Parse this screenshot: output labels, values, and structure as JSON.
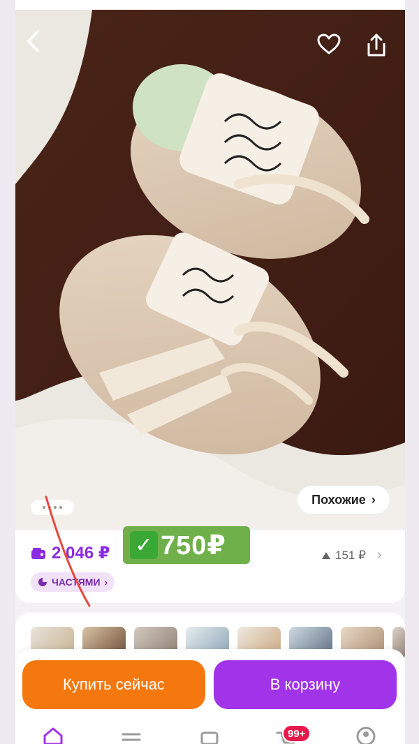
{
  "hero": {
    "similar_label": "Похожие",
    "similar_chevron": "›"
  },
  "price": {
    "current": "2 046 ₽",
    "parts_label": "ЧАСТЯМИ",
    "parts_chevron": "›",
    "promo_text": "750₽",
    "promo_check": "✓",
    "rating_text": "151 ₽",
    "rating_chevron": "›"
  },
  "actions": {
    "buy_now": "Купить сейчас",
    "to_cart": "В корзину"
  },
  "tabbar": {
    "cart_badge": "99+"
  },
  "colors": {
    "accent_purple": "#a133e8",
    "accent_orange": "#f5780f",
    "price_purple": "#8a2be2",
    "promo_green": "#6fb04a",
    "badge_red": "#e6194b"
  },
  "icons": [
    "back-icon",
    "heart-icon",
    "share-icon",
    "wallet-icon",
    "pie-icon",
    "triangle-up-icon",
    "home-icon",
    "catalog-icon",
    "wallet-tab-icon",
    "cart-icon",
    "profile-icon"
  ]
}
